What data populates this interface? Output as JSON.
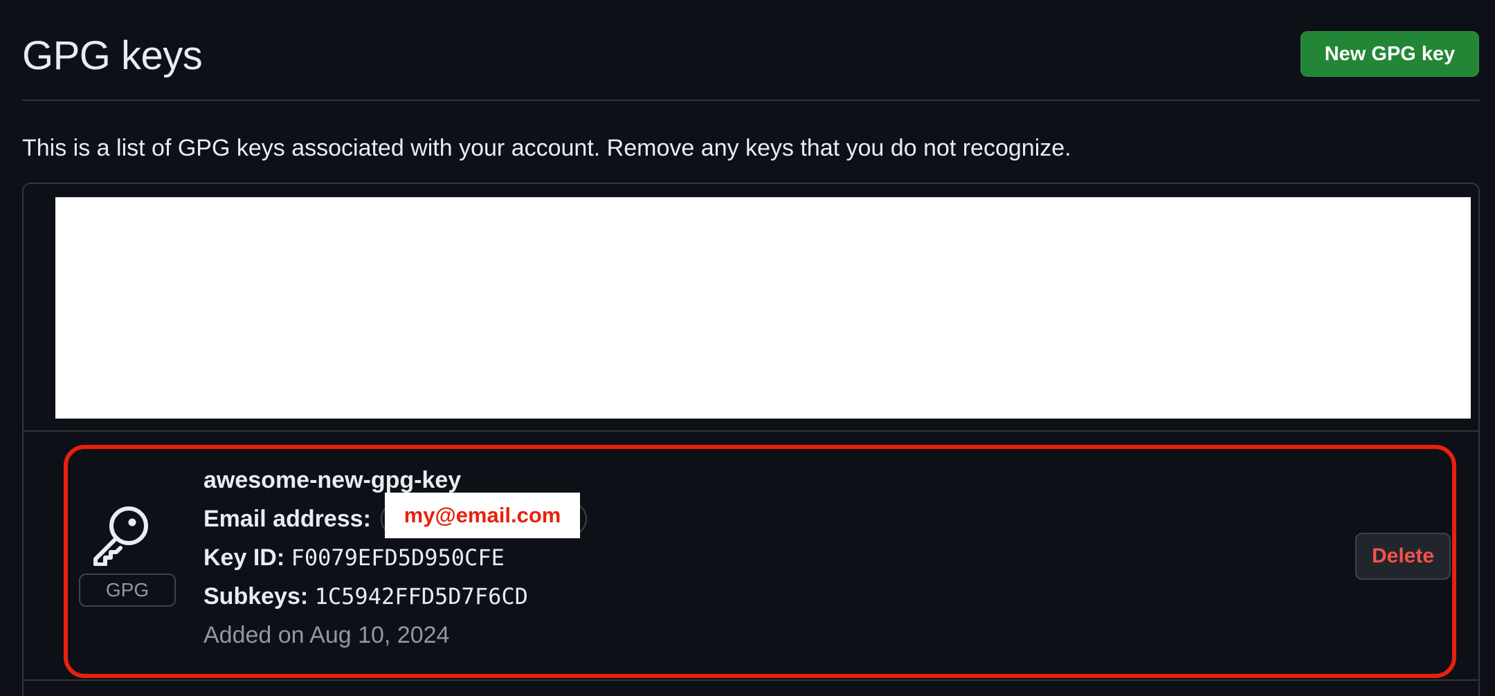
{
  "header": {
    "title": "GPG keys",
    "new_key_button": "New GPG key"
  },
  "description": "This is a list of GPG keys associated with your account. Remove any keys that you do not recognize.",
  "key": {
    "type_badge": "GPG",
    "title": "awesome-new-gpg-key",
    "email_label": "Email address:",
    "email_value": "my@email.com",
    "key_id_label": "Key ID:",
    "key_id_value": "F0079EFD5D950CFE",
    "subkeys_label": "Subkeys:",
    "subkeys_value": "1C5942FFD5D7F6CD",
    "added": "Added on Aug 10, 2024",
    "delete_button": "Delete"
  },
  "colors": {
    "background": "#0d1117",
    "primary_button": "#238636",
    "danger_text": "#f85149",
    "highlight": "#e8210c",
    "redaction": "#ffffff"
  },
  "icons": {
    "key": "key-icon"
  }
}
